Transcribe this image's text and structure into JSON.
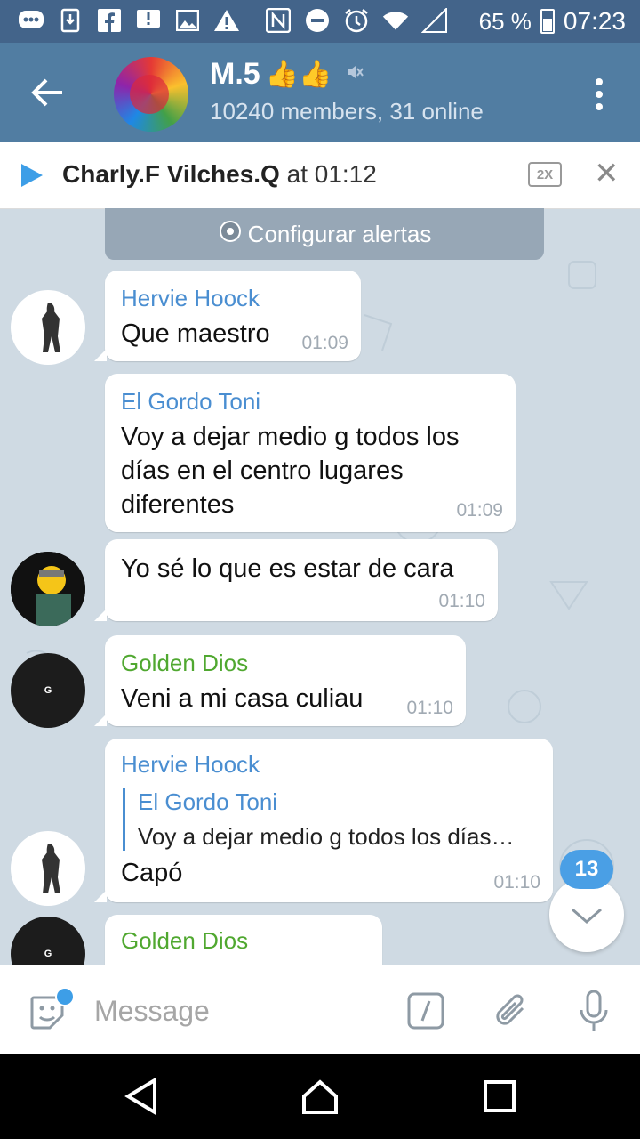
{
  "status_bar": {
    "battery": "65 %",
    "time": "07:23",
    "icons": [
      "chat-bubble-icon",
      "download-icon",
      "facebook-icon",
      "alert-icon",
      "image-icon",
      "warning-icon",
      "nfc-icon",
      "do-not-disturb-icon",
      "alarm-icon",
      "wifi-icon",
      "signal-icon",
      "battery-icon"
    ]
  },
  "header": {
    "title": "M.5",
    "title_emoji": "👍👍",
    "subtitle": "10240 members, 31 online"
  },
  "player": {
    "author": "Charly.F Vilches.Q",
    "at_time": " at 01:12",
    "speed_label": "2X"
  },
  "chat": {
    "alerts_label": "Configurar alertas",
    "messages": [
      {
        "sender": "Hervie Hoock",
        "text": "Que maestro",
        "time": "01:09"
      },
      {
        "sender": "El Gordo Toni",
        "text": "Voy a dejar medio g todos los días en el centro lugares diferentes",
        "time": "01:09"
      },
      {
        "sender": "",
        "text": "Yo sé lo que es estar de cara",
        "time": "01:10"
      },
      {
        "sender": "Golden Dios",
        "text": "Veni a mi casa culiau",
        "time": "01:10"
      },
      {
        "sender": "Hervie Hoock",
        "reply_name": "El Gordo Toni",
        "reply_text": "Voy a dejar medio g todos los días…",
        "text": "Capó",
        "time": "01:10"
      },
      {
        "sender": "Golden Dios",
        "text": "",
        "time": ""
      }
    ],
    "avatar_g_label": "G",
    "unread_count": "13"
  },
  "input": {
    "placeholder": "Message"
  },
  "colors": {
    "header": "#517da2",
    "status_bar": "#43648a",
    "accent": "#3d9ee7",
    "sender_blue": "#4a8ed1",
    "sender_green": "#50a830",
    "chat_background": "#cfdae3"
  }
}
